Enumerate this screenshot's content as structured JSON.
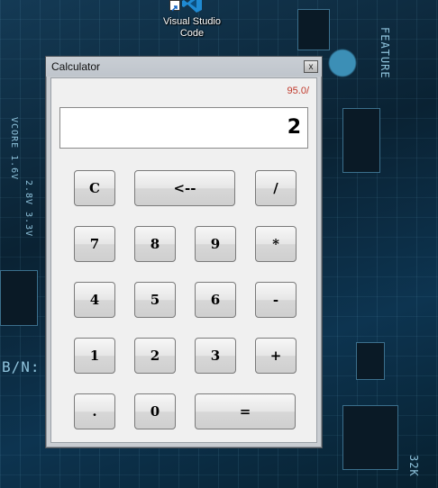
{
  "desktop": {
    "icon_label": "Visual Studio Code",
    "board_text": [
      "FEATURE",
      "VCORE 1.6V",
      "2.8V 3.3V",
      "B/N:",
      "32K"
    ]
  },
  "window": {
    "title": "Calculator",
    "close_label": "x"
  },
  "calculator": {
    "version": "95.0/",
    "display": "2",
    "buttons": {
      "clear": "C",
      "backspace": "<--",
      "divide": "/",
      "seven": "7",
      "eight": "8",
      "nine": "9",
      "multiply": "*",
      "four": "4",
      "five": "5",
      "six": "6",
      "subtract": "-",
      "one": "1",
      "two": "2",
      "three": "3",
      "add": "+",
      "decimal": ".",
      "zero": "0",
      "equals": "="
    }
  }
}
